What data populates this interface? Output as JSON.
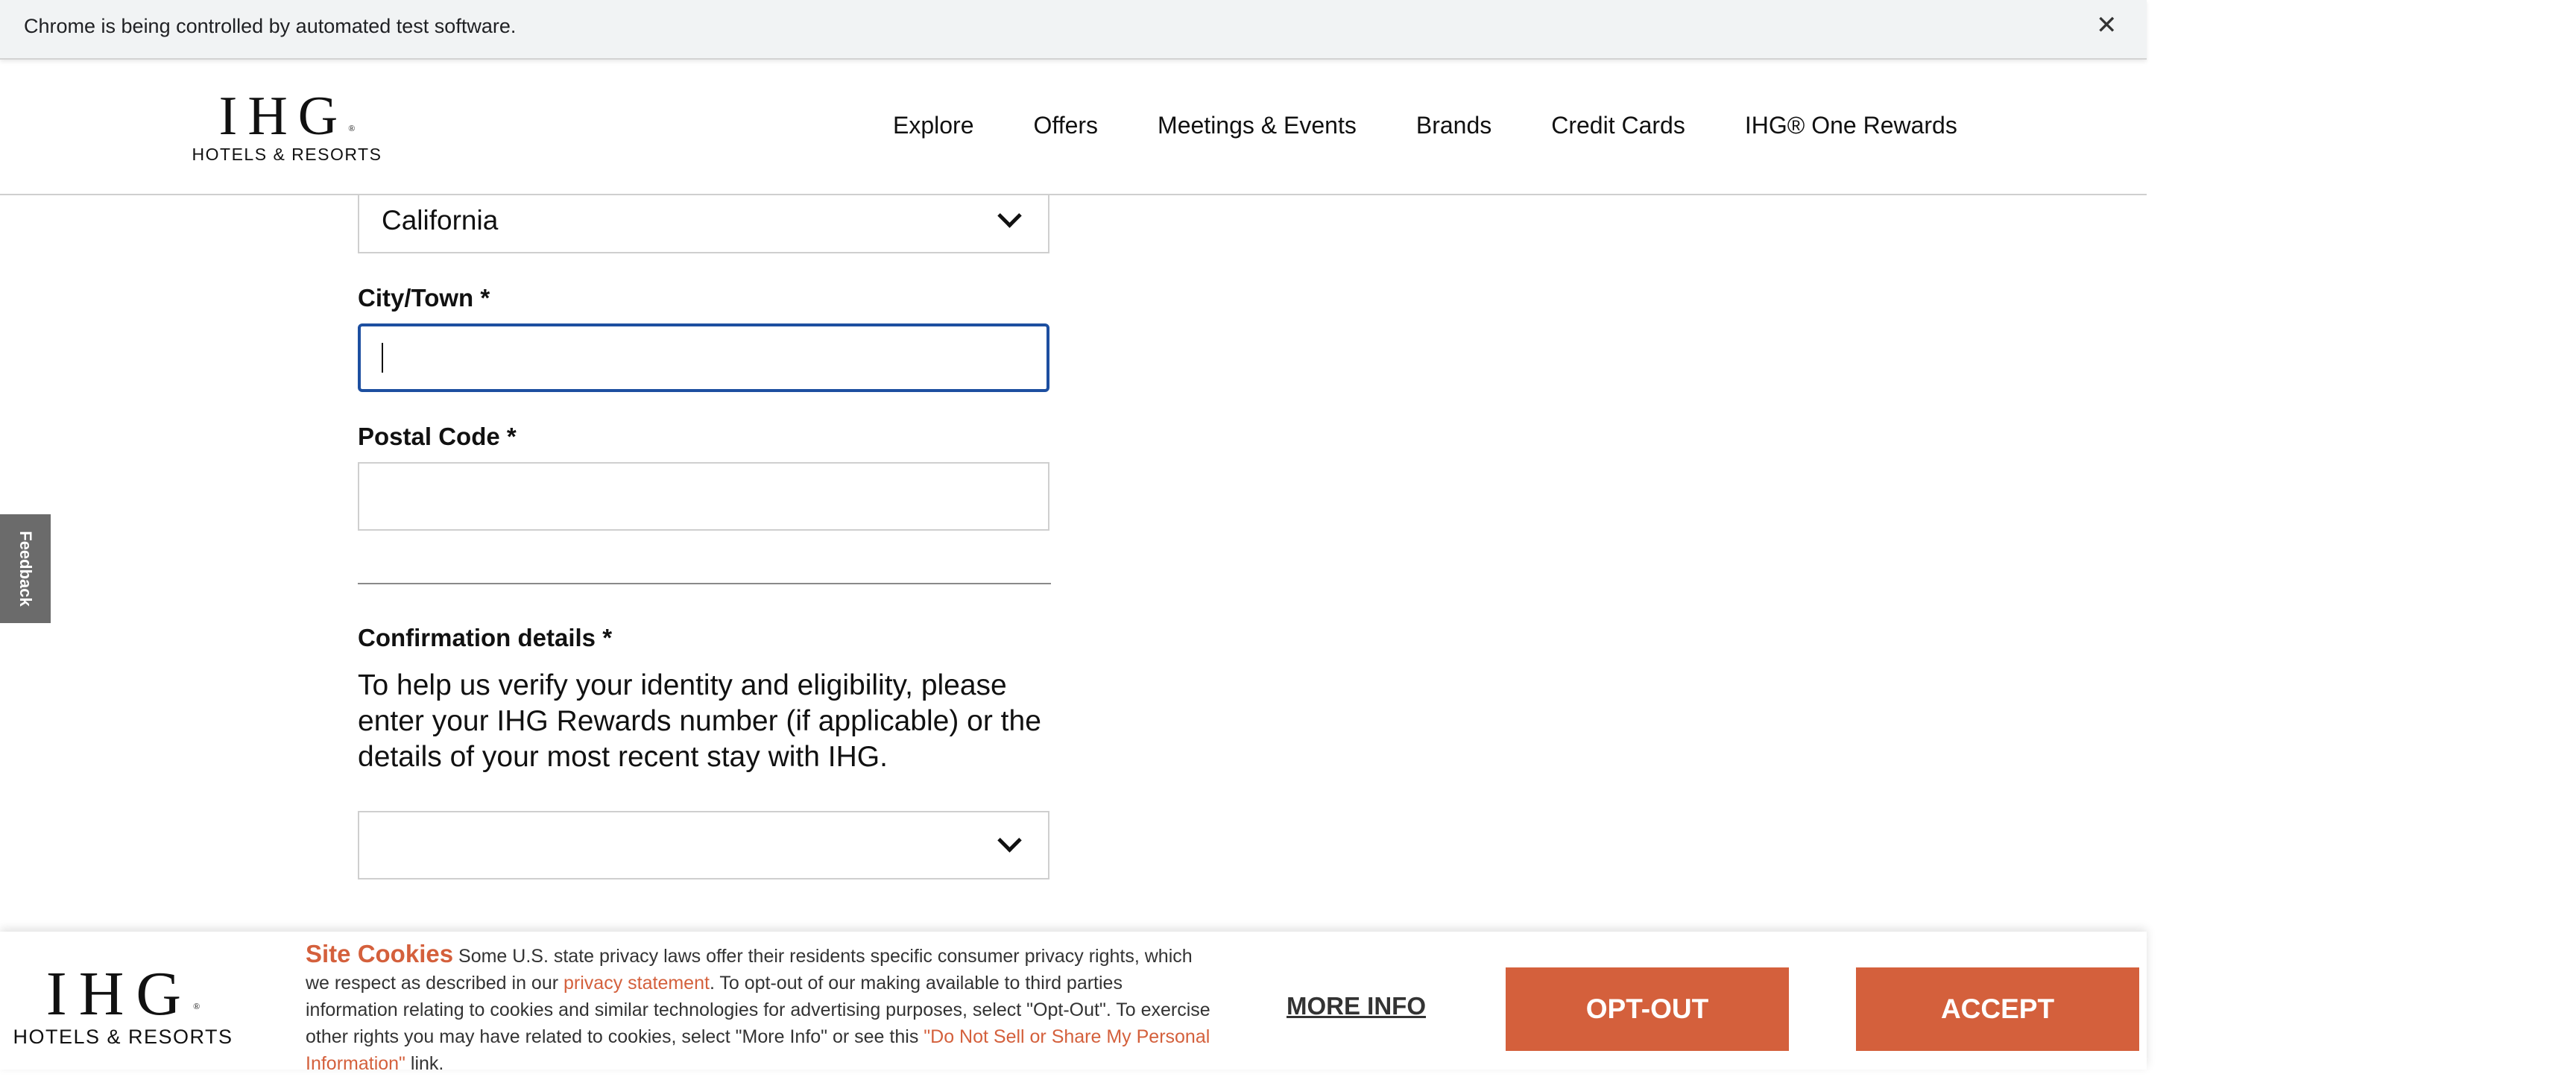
{
  "browser": {
    "infobar_text": "Chrome is being controlled by automated test software.",
    "close_glyph": "✕"
  },
  "header": {
    "logo_mark": "IHG",
    "logo_reg": "®",
    "logo_sub": "HOTELS & RESORTS",
    "nav": [
      "Explore",
      "Offers",
      "Meetings & Events",
      "Brands",
      "Credit Cards",
      "IHG® One Rewards"
    ]
  },
  "form": {
    "state_value": "California",
    "city_label": "City/Town *",
    "city_value": "",
    "postal_label": "Postal Code *",
    "postal_value": "",
    "confirmation_label": "Confirmation details *",
    "confirmation_desc": "To help us verify your identity and eligibility, please enter your IHG Rewards number (if applicable) or the details of your most recent stay with IHG.",
    "confirmation_select_value": ""
  },
  "feedback": {
    "label": "Feedback"
  },
  "cookie": {
    "title": "Site Cookies",
    "text1": " Some U.S. state privacy laws offer their residents specific consumer privacy rights, which we respect as described in our ",
    "link1": "privacy statement",
    "text2": ". To opt-out of our making available to third parties information relating to cookies and similar technologies for advertising purposes, select \"Opt-Out\". To exercise other rights you may have related to cookies, select \"More Info\" or see this ",
    "link2": "\"Do Not Sell or Share My Personal Information\"",
    "text3": " link.",
    "more_info": "MORE INFO",
    "opt_out": "OPT-OUT",
    "accept": "ACCEPT"
  },
  "colors": {
    "accent": "#d4603c",
    "focus": "#1d4fa0",
    "feedback_bg": "#6b6b6b"
  },
  "icons": [
    "close-icon",
    "chevron-down-icon"
  ]
}
